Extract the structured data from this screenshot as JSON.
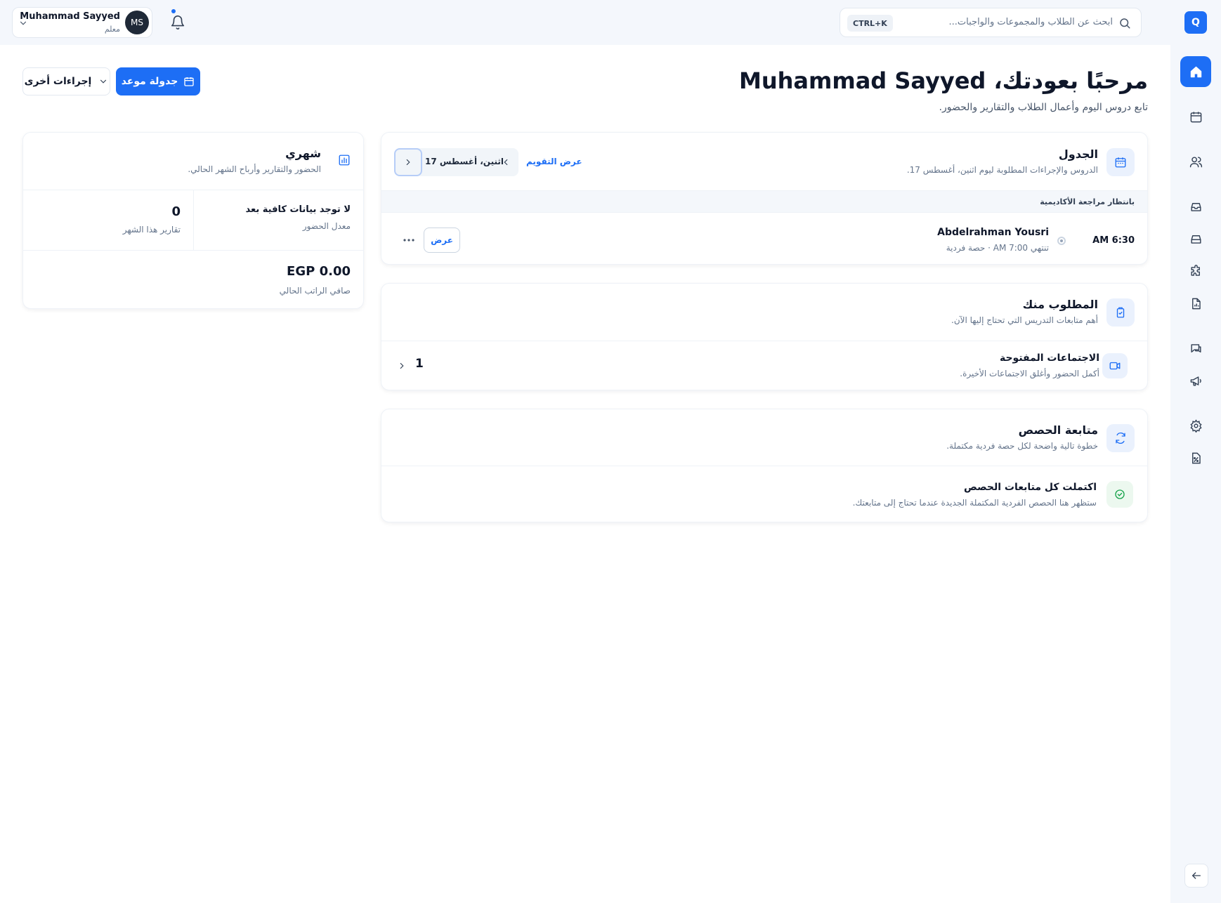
{
  "app": {
    "logo_letter": "Q"
  },
  "search": {
    "placeholder": "ابحث عن الطلاب والمجموعات والواجبات...",
    "shortcut": "CTRL+K"
  },
  "user": {
    "name": "Muhammad Sayyed",
    "role": "معلم",
    "initials": "MS"
  },
  "header": {
    "title": "مرحبًا بعودتك، Muhammad Sayyed",
    "subtitle": "تابع دروس اليوم وأعمال الطلاب والتقارير والحضور.",
    "primary_action": "جدولة موعد",
    "secondary_action": "إجراءات أخرى"
  },
  "schedule": {
    "title": "الجدول",
    "subtitle": "الدروس والإجراءات المطلوبة ليوم اثنين، أغسطس 17.",
    "calendar_link": "عرض التقويم",
    "date_label": "اثنين، أغسطس 17",
    "band_label": "بانتظار مراجعة الأكاديمية",
    "lesson": {
      "time": "AM 6:30",
      "student": "Abdelrahman Yousri",
      "meta": "تنتهي AM 7:00 · حصة فردية",
      "view_label": "عرض"
    }
  },
  "tasks": {
    "title": "المطلوب منك",
    "subtitle": "أهم متابعات التدريس التي تحتاج إليها الآن.",
    "item": {
      "title": "الاجتماعات المفتوحة",
      "subtitle": "أكمل الحضور وأغلق الاجتماعات الأخيرة.",
      "count": "1"
    }
  },
  "followups": {
    "title": "متابعة الحصص",
    "subtitle": "خطوة تالية واضحة لكل حصة فردية مكتملة.",
    "done_title": "اكتملت كل متابعات الحصص",
    "done_subtitle": "ستظهر هنا الحصص الفردية المكتملة الجديدة عندما تحتاج إلى متابعتك."
  },
  "monthly": {
    "title": "شهري",
    "subtitle": "الحضور والتقارير وأرباح الشهر الحالي.",
    "attendance_value": "لا توجد بيانات كافية بعد",
    "attendance_label": "معدل الحضور",
    "reports_value": "0",
    "reports_label": "تقارير هذا الشهر",
    "salary_value": "EGP 0.00",
    "salary_label": "صافي الراتب الحالي"
  },
  "colors": {
    "accent": "#1d6ef5",
    "surface": "#f4f7fc",
    "success": "#16a34a"
  },
  "sidebar_icons": [
    "home-icon",
    "calendar-icon",
    "users-icon",
    "inbox-icon",
    "archive-icon",
    "puzzle-icon",
    "report-icon",
    "chat-icon",
    "megaphone-icon",
    "gear-icon",
    "percent-file-icon"
  ]
}
